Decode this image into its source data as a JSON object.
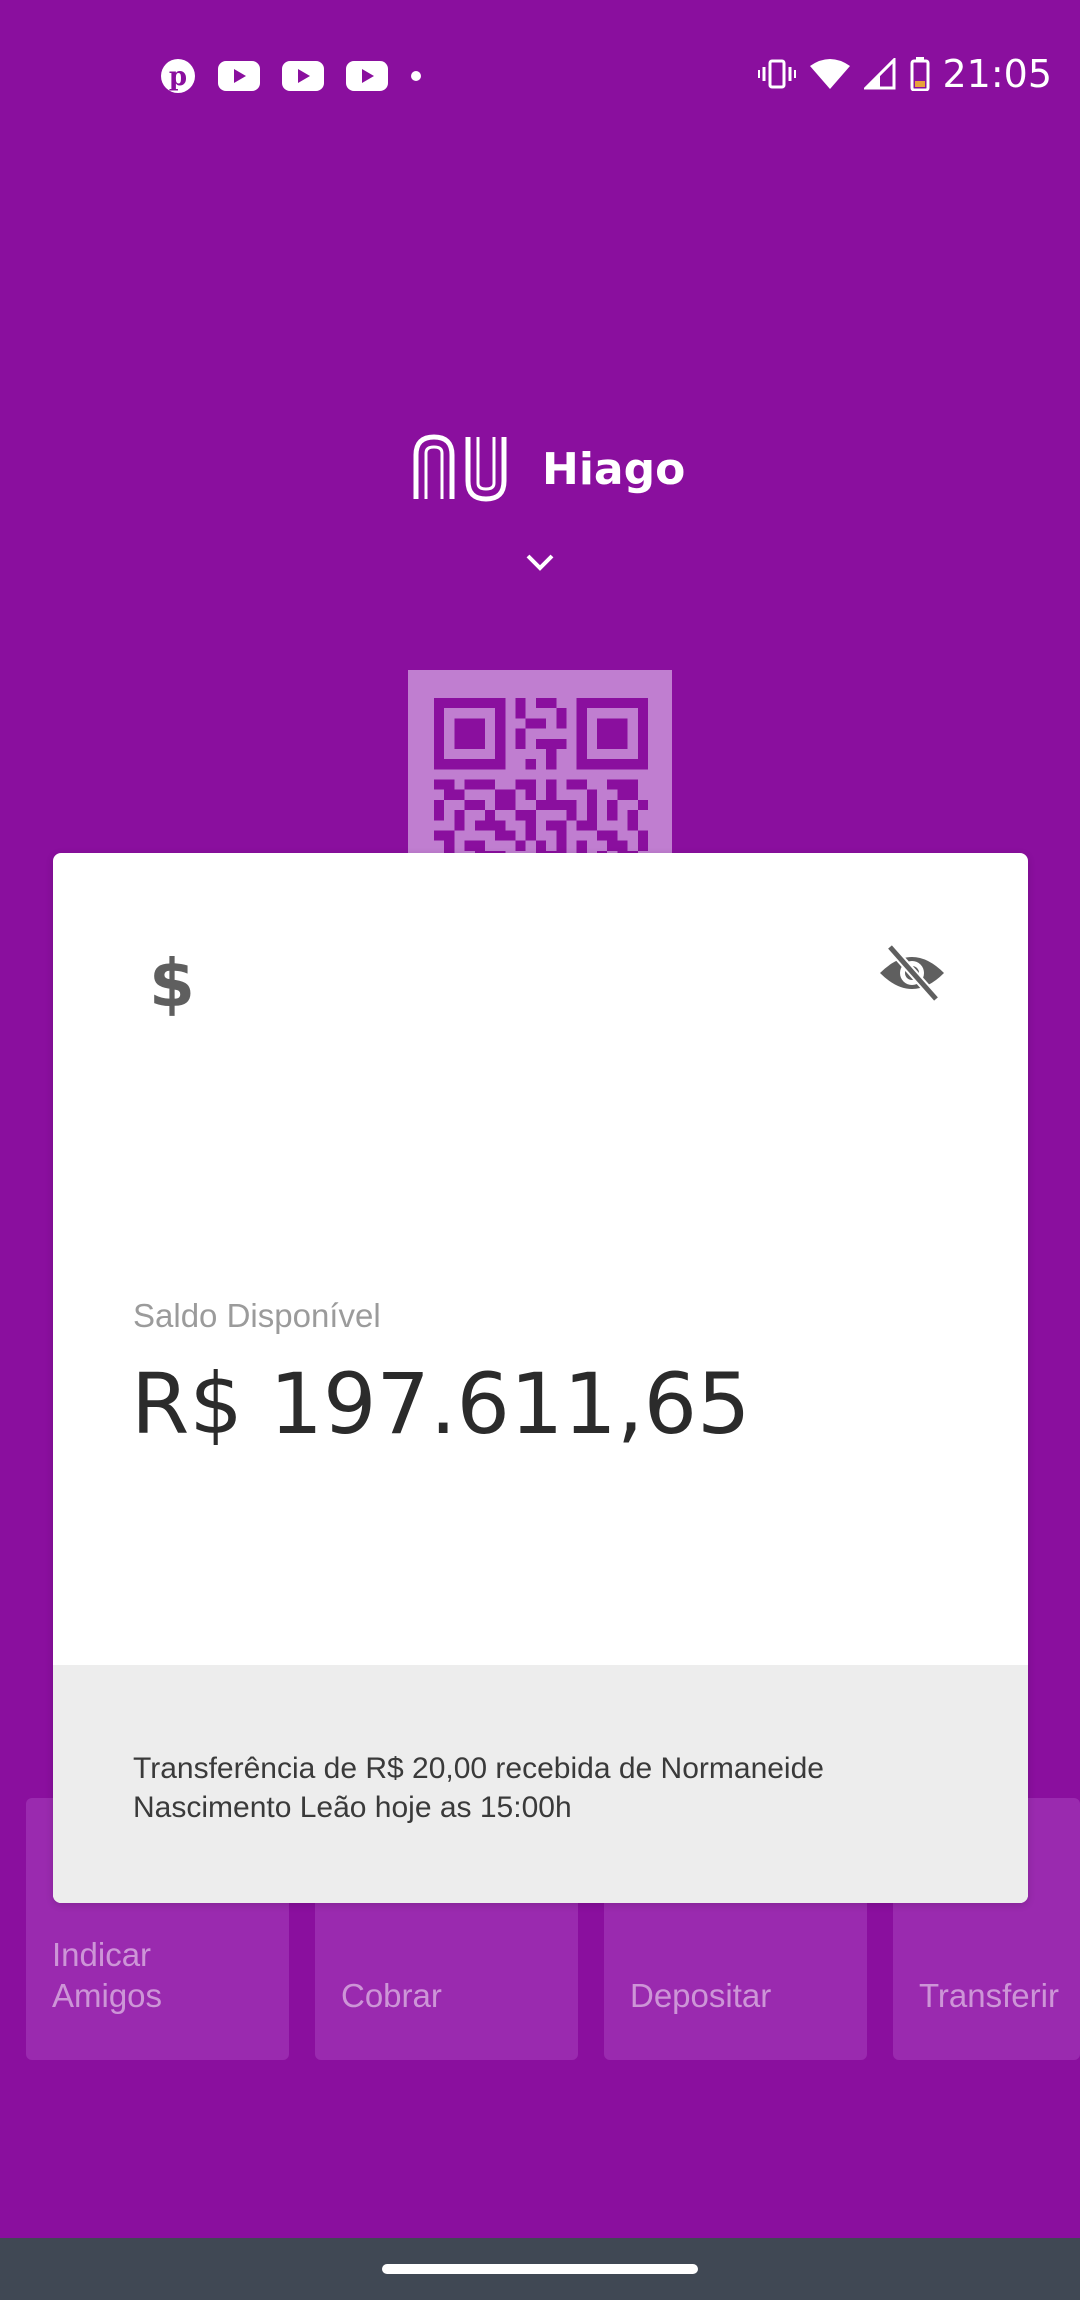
{
  "status_bar": {
    "time": "21:05",
    "notifications": [
      "pinterest-icon",
      "youtube-icon",
      "youtube-icon",
      "youtube-icon",
      "dot-icon"
    ]
  },
  "header": {
    "brand": "nu",
    "user_name": "Hiago"
  },
  "balance_card": {
    "label": "Saldo Disponível",
    "value": "R$ 197.611,65",
    "footer_message": "Transferência de R$ 20,00 recebida de Normaneide Nascimento Leão hoje as 15:00h"
  },
  "shortcuts": [
    {
      "label": "Indicar\nAmigos"
    },
    {
      "label": "Cobrar"
    },
    {
      "label": "Depositar"
    },
    {
      "label": "Transferir"
    }
  ],
  "colors": {
    "brand_purple": "#8A0F9E",
    "tile_purple": "#9A2AAF",
    "card_white": "#FFFFFF",
    "footer_gray": "#EDEDED"
  }
}
